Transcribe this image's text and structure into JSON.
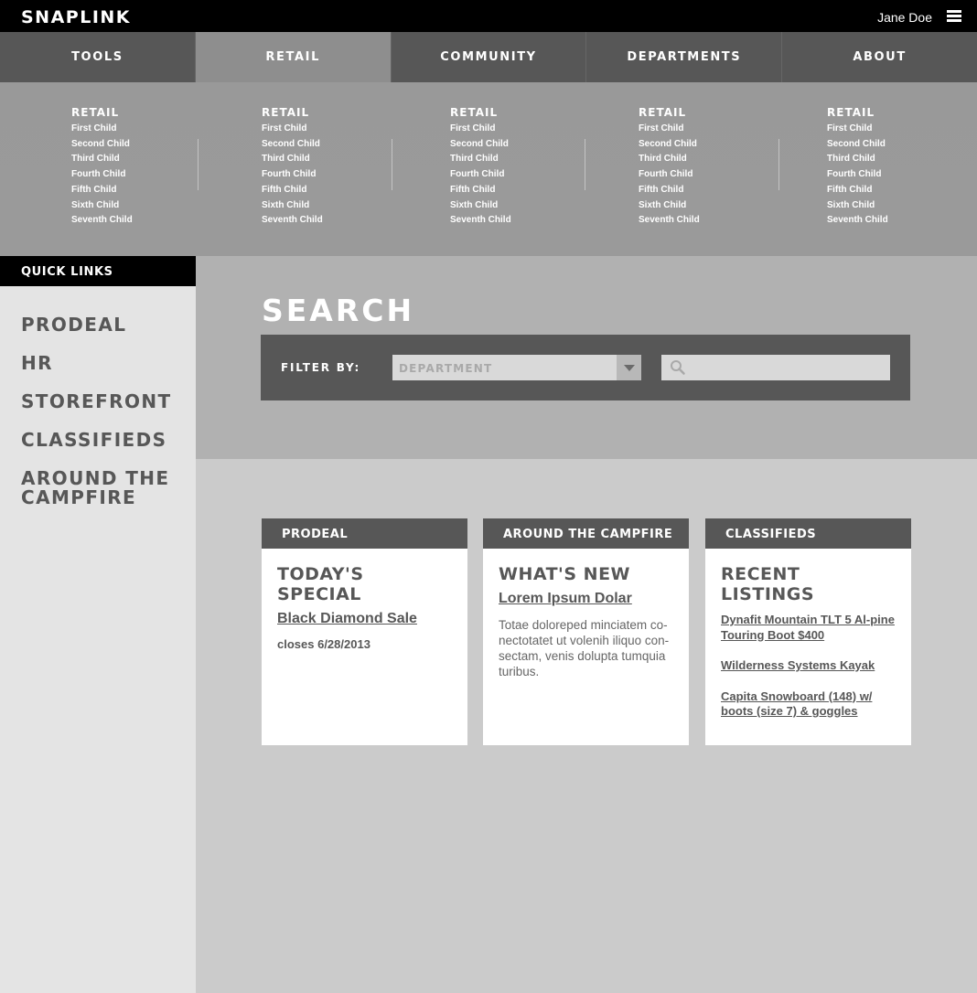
{
  "header": {
    "logo": "SNAPLINK",
    "user_name": "Jane Doe",
    "menu_icon": "hamburger-icon"
  },
  "nav": {
    "tabs": [
      {
        "label": "TOOLS",
        "active": false
      },
      {
        "label": "RETAIL",
        "active": true
      },
      {
        "label": "COMMUNITY",
        "active": false
      },
      {
        "label": "DEPARTMENTS",
        "active": false
      },
      {
        "label": "ABOUT",
        "active": false
      }
    ]
  },
  "megamenu": {
    "columns": [
      {
        "title": "RETAIL",
        "items": [
          "First Child",
          "Second Child",
          "Third Child",
          "Fourth Child",
          "Fifth Child",
          "Sixth Child",
          "Seventh Child"
        ]
      },
      {
        "title": "RETAIL",
        "items": [
          "First Child",
          "Second Child",
          "Third Child",
          "Fourth Child",
          "Fifth Child",
          "Sixth Child",
          "Seventh Child"
        ]
      },
      {
        "title": "RETAIL",
        "items": [
          "First Child",
          "Second Child",
          "Third Child",
          "Fourth Child",
          "Fifth Child",
          "Sixth Child",
          "Seventh Child"
        ]
      },
      {
        "title": "RETAIL",
        "items": [
          "First Child",
          "Second Child",
          "Third Child",
          "Fourth Child",
          "Fifth Child",
          "Sixth Child",
          "Seventh Child"
        ]
      },
      {
        "title": "RETAIL",
        "items": [
          "First Child",
          "Second Child",
          "Third Child",
          "Fourth Child",
          "Fifth Child",
          "Sixth Child",
          "Seventh Child"
        ]
      }
    ]
  },
  "sidebar": {
    "heading": "QUICK LINKS",
    "links": [
      "PRODEAL",
      "HR",
      "STOREFRONT",
      "CLASSIFIEDS",
      "AROUND THE CAMPFIRE"
    ]
  },
  "search": {
    "title": "SEARCH",
    "filter_label": "FILTER BY:",
    "select_value": "DEPARTMENT",
    "input_value": "",
    "search_icon": "search-icon"
  },
  "cards": {
    "prodeal": {
      "header": "PRODEAL",
      "title": "TODAY'S SPECIAL",
      "link": "Black Diamond Sale",
      "meta": "closes 6/28/2013"
    },
    "campfire": {
      "header": "AROUND THE CAMPFIRE",
      "title": "WHAT'S NEW",
      "link": "Lorem Ipsum Dolar",
      "text": "Totae doloreped minciatem co-nectotatet ut volenih iliquo con-sectam, venis dolupta tumquia turibus."
    },
    "classifieds": {
      "header": "CLASSIFIEDS",
      "title": "RECENT LISTINGS",
      "listings": [
        "Dynafit Mountain TLT 5 Al-pine Touring Boot $400",
        "Wilderness Systems Kayak",
        "Capita Snowboard (148) w/ boots (size 7) & goggles"
      ]
    }
  },
  "colors": {
    "topbar": "#000000",
    "nav": "#575757",
    "nav_active": "#8e8e8e",
    "megamenu": "#999999",
    "sidebar": "#e4e4e4",
    "search_band": "#b1b1b1",
    "content_bg": "#cbcbcb",
    "text_dark": "#575757"
  }
}
